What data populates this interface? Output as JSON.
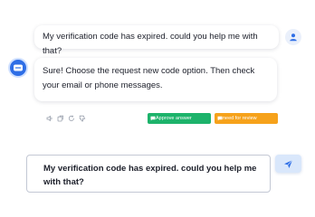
{
  "conversation": {
    "user_message": "My verification code has expired. could you help me with that?",
    "bot_message": "Sure! Choose the request new code option. Then check your email or phone messages."
  },
  "actions": {
    "icons": [
      "speaker-icon",
      "copy-icon",
      "regenerate-icon",
      "thumbs-down-icon"
    ],
    "approve_label": "Approve answer",
    "review_label": "need for review",
    "approve_color": "#1db36b",
    "review_color": "#f6a21b"
  },
  "composer": {
    "value": "My verification code has expired. could you help me with that?"
  },
  "colors": {
    "accent": "#2e6ee6",
    "send_button_bg": "#d9e7fb"
  }
}
